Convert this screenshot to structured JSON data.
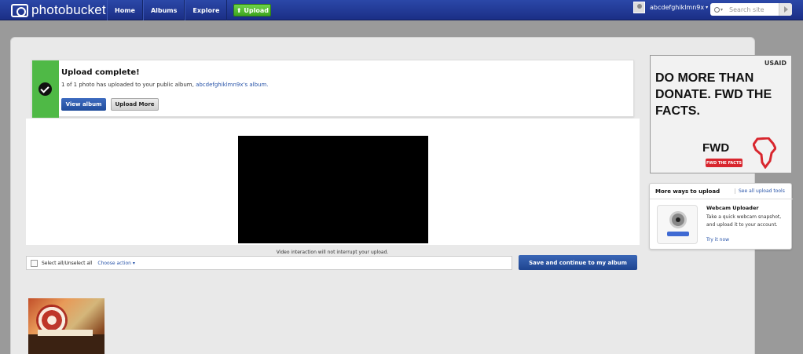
{
  "header": {
    "logo_text": "photobucket",
    "nav": [
      "Home",
      "Albums",
      "Explore"
    ],
    "upload_label": "Upload",
    "username": "abcdefghiklmn9x",
    "search_placeholder": "Search site"
  },
  "notice": {
    "title": "Upload complete!",
    "message_prefix": "1 of 1 photo has uploaded to your public album,",
    "album_link": "abcdefghiklmn9x's album.",
    "view_album": "View album",
    "upload_more": "Upload More"
  },
  "video": {
    "note": "Video interaction will not interrupt your upload."
  },
  "selection": {
    "select_all": "Select all/Unselect all",
    "choose_action": "Choose action ▾",
    "save_button": "Save and continue to my album"
  },
  "ad": {
    "sponsor": "USAID",
    "headline": "DO MORE THAN DONATE. FWD THE FACTS.",
    "fwd": "FWD",
    "badge": "FWD THE FACTS"
  },
  "tools": {
    "title": "More ways to upload",
    "see_all": "See all upload tools",
    "webcam_title": "Webcam Uploader",
    "webcam_desc": "Take a quick webcam snapshot, and upload it to your account.",
    "try_now": "Try it now"
  },
  "colors": {
    "header_blue": "#1b2f86",
    "success_green": "#4fb946",
    "link_blue": "#2753a8",
    "ad_red": "#d8262e"
  }
}
